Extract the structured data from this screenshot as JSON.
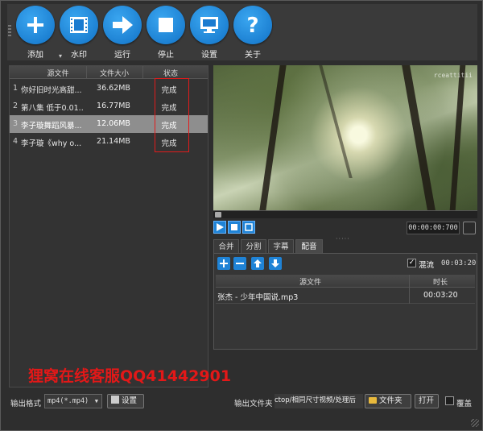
{
  "toolbar": {
    "buttons": [
      {
        "label": "添加",
        "icon": "plus-icon"
      },
      {
        "label": "水印",
        "icon": "film-icon"
      },
      {
        "label": "运行",
        "icon": "arrow-right-icon"
      },
      {
        "label": "停止",
        "icon": "stop-icon"
      },
      {
        "label": "设置",
        "icon": "monitor-icon"
      },
      {
        "label": "关于",
        "icon": "question-icon"
      }
    ],
    "add_dropdown": "▾"
  },
  "file_table": {
    "headers": {
      "source": "源文件",
      "size": "文件大小",
      "status": "状态"
    },
    "rows": [
      {
        "index": "1",
        "name": "你好旧时光高甜...",
        "size": "36.62MB",
        "status": "完成"
      },
      {
        "index": "2",
        "name": "第八集 低于0.01...",
        "size": "16.77MB",
        "status": "完成"
      },
      {
        "index": "3",
        "name": "李子璇舞蹈风暴...",
        "size": "12.06MB",
        "status": "完成"
      },
      {
        "index": "4",
        "name": "李子璇《why o...",
        "size": "21.14MB",
        "status": "完成"
      }
    ],
    "selected_index": 3,
    "highlight_color": "#e21b1b"
  },
  "preview": {
    "corner_text": "rceattitii"
  },
  "player": {
    "timecode": "00:00:00:700"
  },
  "tabs": [
    {
      "label": "合并",
      "active": false
    },
    {
      "label": "分割",
      "active": false
    },
    {
      "label": "字幕",
      "active": false
    },
    {
      "label": "配音",
      "active": true
    }
  ],
  "audio": {
    "mix_checked": true,
    "mix_label": "混流",
    "mix_time": "00:03:20",
    "headers": {
      "source": "源文件",
      "duration": "时长"
    },
    "rows": [
      {
        "name": "张杰 - 少年中国说.mp3",
        "duration": "00:03:20"
      }
    ]
  },
  "promo_text": "狸窝在线客服QQ41442901",
  "bottom": {
    "output_format_label": "输出格式",
    "format_value": "mp4(*.mp4)",
    "settings_button": "设置",
    "output_folder_label": "输出文件夹",
    "output_path": "ctop/相同尺寸视频/处理后",
    "folder_button": "文件夹",
    "open_button": "打开",
    "overwrite_label": "覆盖"
  },
  "colors": {
    "accent_blue": "#1f83d6",
    "promo_red": "#e31818"
  }
}
